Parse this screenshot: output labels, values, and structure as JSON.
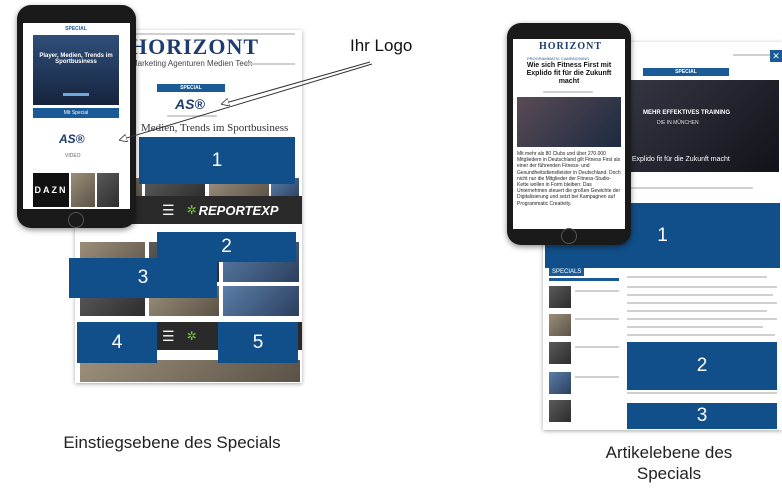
{
  "left": {
    "masthead": "HORIZONT",
    "nav": "Marketing Agenturen Medien Tech",
    "special_label": "SPECIAL",
    "partner_logo": "AS®",
    "headline": "Medien, Trends im Sportbusiness",
    "report_brand": "REPORTEXP",
    "phone_special_label": "SPECIAL",
    "phone_logo": "AS®",
    "phone_headline": "Player, Medien, Trends im Sportbusiness",
    "phone_button": "Mit Special",
    "phone_title": "VIDEO",
    "phone_tile": "DAZN",
    "boxes": [
      "1",
      "2",
      "3",
      "4",
      "5"
    ],
    "caption": "Einstiegsebene des Specials"
  },
  "callout": {
    "label": "Ihr Logo"
  },
  "right": {
    "masthead": "HORIZONT",
    "special_label": "SPECIAL",
    "banner_title": "MEHR EFFEKTIVES TRAINING",
    "banner_sub": "DIE IN MÜNCHEN",
    "banner_caption": "First mit Explido fit für die Zukunft macht",
    "phone_masthead": "HORIZONT",
    "phone_kicker": "PROGRAMMATIC CAMPAIGNING",
    "phone_headline": "Wie sich Fitness First mit Explido fit für die Zukunft macht",
    "phone_body": "Mit mehr als 80 Clubs und über 270.000 Mitgliedern in Deutschland gilt Fitness First als einer der führenden Fitness- und Gesundheitsdienstleister in Deutschland. Doch nicht nur die Mitglieder der Fitness-Studio-Kette wollen in Form bleiben: Das Unternehmen steuert die großen Gewichte der Digitalisierung und setzt bei Kampagnen auf Programmatic Creativity.",
    "sidebar_label": "SPECIALS",
    "boxes": [
      "1",
      "2",
      "3"
    ],
    "caption": "Artikelebene des Specials"
  },
  "colors": {
    "box": "#114f8a",
    "accent": "#1a5a96"
  }
}
